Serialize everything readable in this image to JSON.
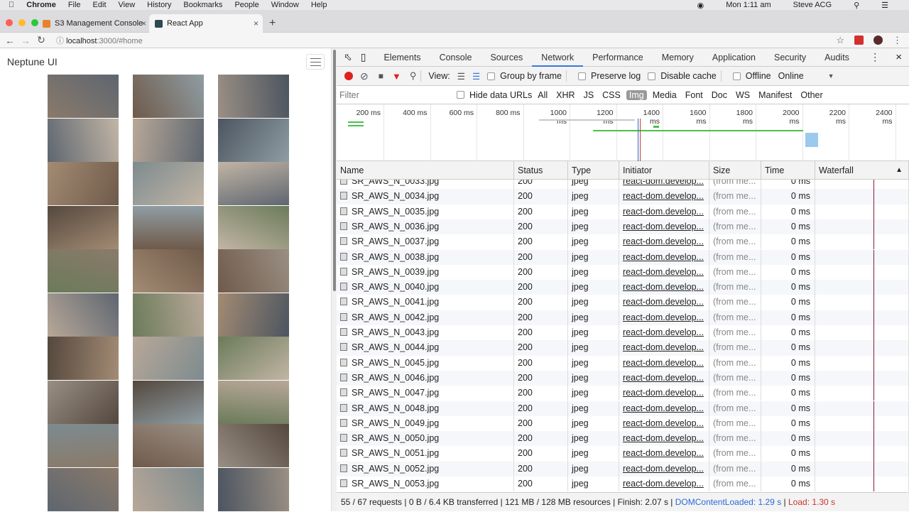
{
  "menubar": {
    "app": "Chrome",
    "items": [
      "File",
      "Edit",
      "View",
      "History",
      "Bookmarks",
      "People",
      "Window",
      "Help"
    ],
    "clock": "Mon 1:11 am",
    "user": "Steve ACG"
  },
  "tabs": [
    {
      "title": "S3 Management Console",
      "favicon_color": "#e8822f"
    },
    {
      "title": "React App",
      "favicon_color": "#2b4a4f",
      "active": true
    }
  ],
  "address": {
    "host": "localhost",
    "rest": ":3000/#home"
  },
  "page": {
    "brand": "Neptune UI"
  },
  "devtools": {
    "tabs": [
      "Elements",
      "Console",
      "Sources",
      "Network",
      "Performance",
      "Memory",
      "Application",
      "Security",
      "Audits"
    ],
    "active_tab": "Network",
    "controls": {
      "view_label": "View:",
      "group_by_frame": "Group by frame",
      "preserve_log": "Preserve log",
      "disable_cache": "Disable cache",
      "offline": "Offline",
      "throttle": "Online"
    },
    "filter": {
      "placeholder": "Filter",
      "hide_data_urls": "Hide data URLs",
      "types": [
        "All",
        "XHR",
        "JS",
        "CSS",
        "Img",
        "Media",
        "Font",
        "Doc",
        "WS",
        "Manifest",
        "Other"
      ],
      "selected": "Img"
    },
    "timeline_ticks": [
      "200 ms",
      "400 ms",
      "600 ms",
      "800 ms",
      "1000 ms",
      "1200 ms",
      "1400 ms",
      "1600 ms",
      "1800 ms",
      "2000 ms",
      "2200 ms",
      "2400 ms"
    ],
    "columns": [
      "Name",
      "Status",
      "Type",
      "Initiator",
      "Size",
      "Time",
      "Waterfall"
    ],
    "rows": [
      {
        "name": "SR_AWS_N_0033.jpg",
        "status": "200",
        "type": "jpeg",
        "initiator": "react-dom.develop...",
        "size": "(from me...",
        "time": "0 ms"
      },
      {
        "name": "SR_AWS_N_0034.jpg",
        "status": "200",
        "type": "jpeg",
        "initiator": "react-dom.develop...",
        "size": "(from me...",
        "time": "0 ms"
      },
      {
        "name": "SR_AWS_N_0035.jpg",
        "status": "200",
        "type": "jpeg",
        "initiator": "react-dom.develop...",
        "size": "(from me...",
        "time": "0 ms"
      },
      {
        "name": "SR_AWS_N_0036.jpg",
        "status": "200",
        "type": "jpeg",
        "initiator": "react-dom.develop...",
        "size": "(from me...",
        "time": "0 ms"
      },
      {
        "name": "SR_AWS_N_0037.jpg",
        "status": "200",
        "type": "jpeg",
        "initiator": "react-dom.develop...",
        "size": "(from me...",
        "time": "0 ms"
      },
      {
        "name": "SR_AWS_N_0038.jpg",
        "status": "200",
        "type": "jpeg",
        "initiator": "react-dom.develop...",
        "size": "(from me...",
        "time": "0 ms"
      },
      {
        "name": "SR_AWS_N_0039.jpg",
        "status": "200",
        "type": "jpeg",
        "initiator": "react-dom.develop...",
        "size": "(from me...",
        "time": "0 ms"
      },
      {
        "name": "SR_AWS_N_0040.jpg",
        "status": "200",
        "type": "jpeg",
        "initiator": "react-dom.develop...",
        "size": "(from me...",
        "time": "0 ms"
      },
      {
        "name": "SR_AWS_N_0041.jpg",
        "status": "200",
        "type": "jpeg",
        "initiator": "react-dom.develop...",
        "size": "(from me...",
        "time": "0 ms"
      },
      {
        "name": "SR_AWS_N_0042.jpg",
        "status": "200",
        "type": "jpeg",
        "initiator": "react-dom.develop...",
        "size": "(from me...",
        "time": "0 ms"
      },
      {
        "name": "SR_AWS_N_0043.jpg",
        "status": "200",
        "type": "jpeg",
        "initiator": "react-dom.develop...",
        "size": "(from me...",
        "time": "0 ms"
      },
      {
        "name": "SR_AWS_N_0044.jpg",
        "status": "200",
        "type": "jpeg",
        "initiator": "react-dom.develop...",
        "size": "(from me...",
        "time": "0 ms"
      },
      {
        "name": "SR_AWS_N_0045.jpg",
        "status": "200",
        "type": "jpeg",
        "initiator": "react-dom.develop...",
        "size": "(from me...",
        "time": "0 ms"
      },
      {
        "name": "SR_AWS_N_0046.jpg",
        "status": "200",
        "type": "jpeg",
        "initiator": "react-dom.develop...",
        "size": "(from me...",
        "time": "0 ms"
      },
      {
        "name": "SR_AWS_N_0047.jpg",
        "status": "200",
        "type": "jpeg",
        "initiator": "react-dom.develop...",
        "size": "(from me...",
        "time": "0 ms"
      },
      {
        "name": "SR_AWS_N_0048.jpg",
        "status": "200",
        "type": "jpeg",
        "initiator": "react-dom.develop...",
        "size": "(from me...",
        "time": "0 ms"
      },
      {
        "name": "SR_AWS_N_0049.jpg",
        "status": "200",
        "type": "jpeg",
        "initiator": "react-dom.develop...",
        "size": "(from me...",
        "time": "0 ms"
      },
      {
        "name": "SR_AWS_N_0050.jpg",
        "status": "200",
        "type": "jpeg",
        "initiator": "react-dom.develop...",
        "size": "(from me...",
        "time": "0 ms"
      },
      {
        "name": "SR_AWS_N_0051.jpg",
        "status": "200",
        "type": "jpeg",
        "initiator": "react-dom.develop...",
        "size": "(from me...",
        "time": "0 ms"
      },
      {
        "name": "SR_AWS_N_0052.jpg",
        "status": "200",
        "type": "jpeg",
        "initiator": "react-dom.develop...",
        "size": "(from me...",
        "time": "0 ms"
      },
      {
        "name": "SR_AWS_N_0053.jpg",
        "status": "200",
        "type": "jpeg",
        "initiator": "react-dom.develop...",
        "size": "(from me...",
        "time": "0 ms"
      }
    ],
    "summary": {
      "requests": "55 / 67 requests",
      "transferred": "0 B / 6.4 KB transferred",
      "resources": "121 MB / 128 MB resources",
      "finish": "Finish: 2.07 s",
      "dcl": "DOMContentLoaded: 1.29 s",
      "load": "Load: 1.30 s",
      "dcl_color": "#2a6ad8",
      "load_color": "#c8352b"
    }
  }
}
